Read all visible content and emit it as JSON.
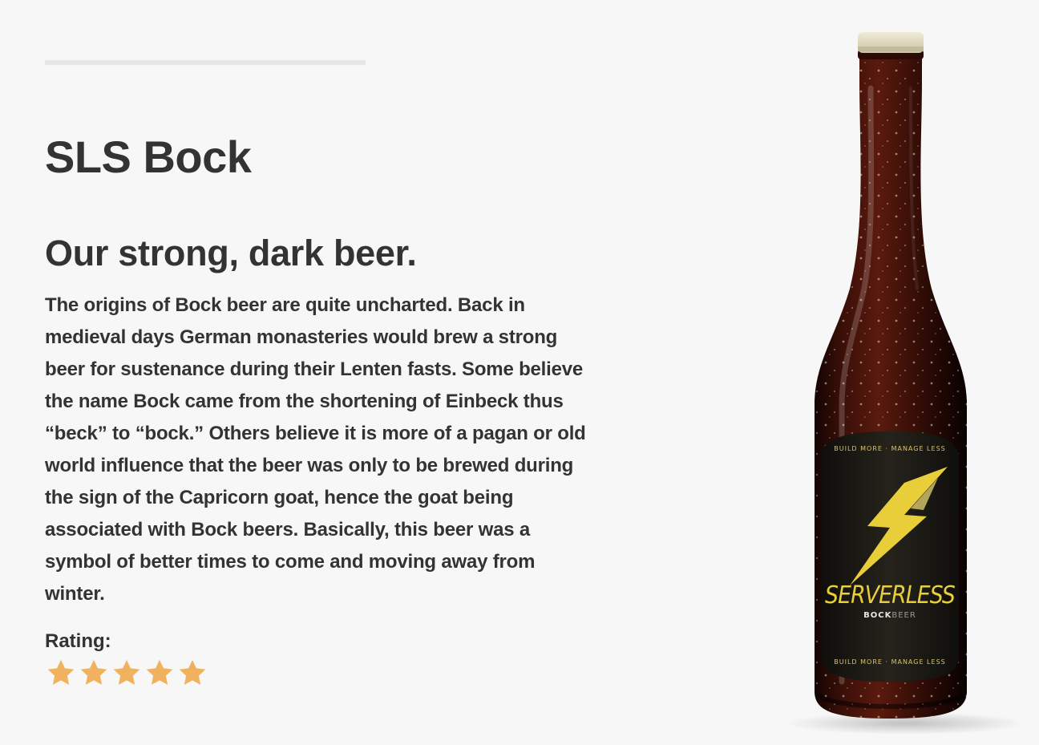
{
  "product": {
    "title": "SLS Bock",
    "tagline": "Our strong, dark beer.",
    "description": "The origins of Bock beer are quite uncharted. Back in medieval days German monasteries would brew a strong beer for sustenance during their Lenten fasts. Some believe the name Bock came from the shortening of Einbeck thus “beck” to “bock.” Others believe it is more of a pagan or old world influence that the beer was only to be brewed during the sign of the Capricorn goat, hence the goat being associated with Bock beers. Basically, this beer was a symbol of better times to come and moving away from winter.",
    "rating_label": "Rating:",
    "rating_value": 5,
    "rating_max": 5
  },
  "bottle_label": {
    "top_text": "BUILD MORE · MANAGE LESS",
    "brand": "SERVERLESS",
    "type_bold": "BOCK",
    "type_light": "BEER",
    "bottom_text": "BUILD MORE · MANAGE LESS"
  },
  "colors": {
    "background": "#f7f7f7",
    "text": "#333333",
    "divider": "#e6e6e6",
    "star": "#f0b25e",
    "bottle_glass": "#3a0f08",
    "bottle_label": "#1c1a15",
    "label_gold": "#e8cf3a"
  }
}
